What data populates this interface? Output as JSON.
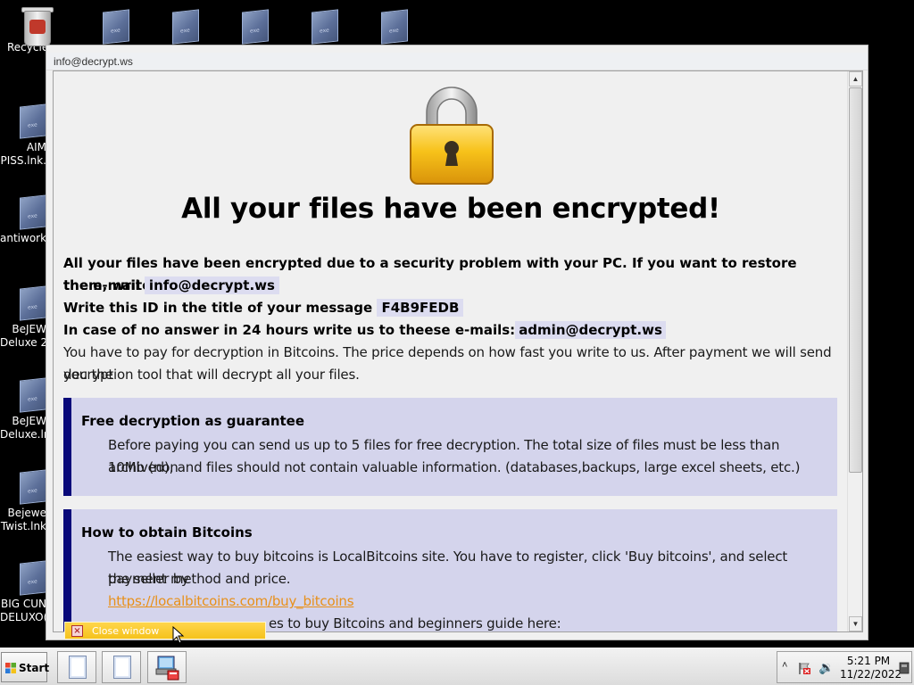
{
  "desktop": {
    "icons": [
      {
        "label": "Recycle"
      },
      {
        "label": "AIM\nPISS.lnk."
      },
      {
        "label": "antiwork."
      },
      {
        "label": "BeJEW\nDeluxe 2."
      },
      {
        "label": "BeJEW\nDeluxe.ln"
      },
      {
        "label": "Bejewe\nTwist.lnk"
      },
      {
        "label": "BIG CUN\nDELUXO("
      }
    ]
  },
  "window": {
    "title": "info@decrypt.ws",
    "headline": "All your files have been encrypted!",
    "line1": "All your files have been encrypted due to a security problem with your PC. If you want to restore them, write us to",
    "line2_prefix": "the e-mail",
    "email": "info@decrypt.ws",
    "line3_prefix": "Write this ID in the title of your message",
    "id": "F4B9FEDB",
    "line4_prefix": "In case of no answer in 24 hours write us to theese e-mails:",
    "email2": "admin@decrypt.ws",
    "pay_line1": "You have to pay for decryption in Bitcoins. The price depends on how fast you write to us. After payment we will send you the",
    "pay_line2": "decryption tool that will decrypt all your files.",
    "box1": {
      "title": "Free decryption as guarantee",
      "line1": "Before paying you can send us up to 5 files for free decryption. The total size of files must be less than 10Mb (non",
      "line2": "archived), and files should not contain valuable information. (databases,backups, large excel sheets, etc.)"
    },
    "box2": {
      "title": "How to obtain Bitcoins",
      "line1": "The easiest way to buy bitcoins is LocalBitcoins site. You have to register, click 'Buy bitcoins', and select the seller by",
      "line2": "payment method and price.",
      "link": "https://localbitcoins.com/buy_bitcoins",
      "line4": "es to buy Bitcoins and beginners guide here:"
    },
    "close_bar_label": "Close window"
  },
  "taskbar": {
    "start_label": "Start",
    "time": "5:21 PM",
    "date": "11/22/2022",
    "tray_arrow": "˄",
    "volume_glyph": "🔉"
  },
  "colors": {
    "accent_box": "#d4d4ec",
    "box_border": "#0a0a7a",
    "link": "#e8901a",
    "close_bar": "#f5c21c"
  }
}
